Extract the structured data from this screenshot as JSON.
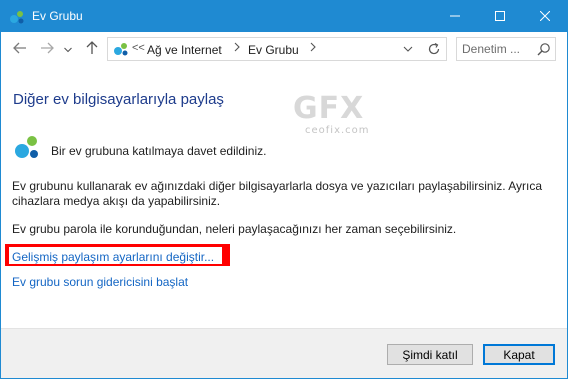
{
  "window": {
    "title": "Ev Grubu",
    "icon": "homegroup-icon",
    "controls": [
      "minimize-icon",
      "maximize-icon",
      "close-icon"
    ]
  },
  "navigation": {
    "back": "arrow-left-icon",
    "forward": "arrow-right-icon",
    "recent": "chevron-down-icon",
    "up": "arrow-up-icon",
    "address": {
      "overflow": "<<",
      "breadcrumbs": [
        "Ağ ve Internet",
        "Ev Grubu"
      ]
    },
    "search": {
      "placeholder": "Denetim ..."
    }
  },
  "content": {
    "heading": "Diğer ev bilgisayarlarıyla paylaş",
    "invite_text": "Bir ev grubuna katılmaya davet edildiniz.",
    "paragraph1": "Ev grubunu kullanarak ev ağınızdaki diğer bilgisayarlarla dosya ve yazıcıları paylaşabilirsiniz. Ayrıca cihazlara medya akışı da yapabilirsiniz.",
    "paragraph2": "Ev grubu parola ile korunduğundan, neleri paylaşacağınızı her zaman seçebilirsiniz.",
    "link_advanced": "Gelişmiş paylaşım ayarlarını değiştir...",
    "link_troubleshoot": "Ev grubu sorun gidericisini başlat",
    "watermark_logo": "GFX",
    "watermark_site": "ceofix.com"
  },
  "footer": {
    "join_label": "Şimdi katıl",
    "close_label": "Kapat"
  },
  "colors": {
    "titlebar": "#1f8ad2",
    "heading": "#1e3c8c",
    "link": "#1466c4",
    "highlight": "#ff0000"
  }
}
